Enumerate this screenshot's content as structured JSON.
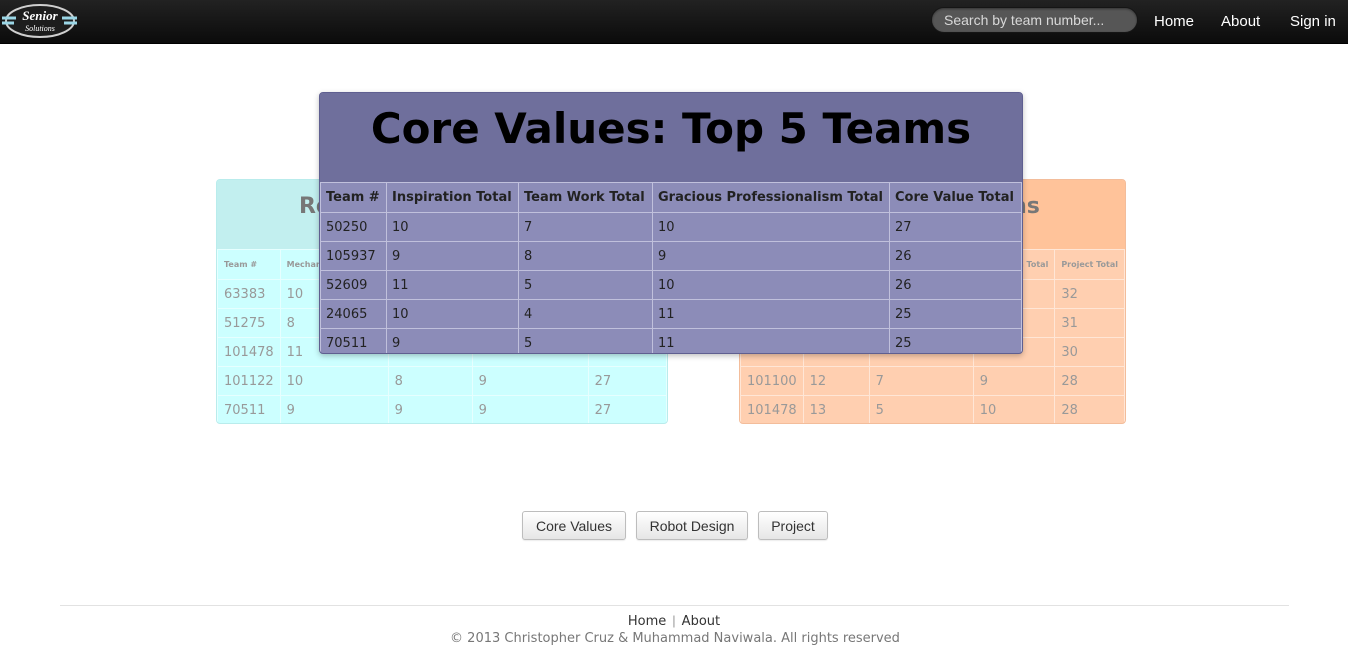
{
  "navbar": {
    "logo_text": "Senior Solutions",
    "search_placeholder": "Search by team number...",
    "links": [
      "Home",
      "About",
      "Sign in"
    ]
  },
  "robot_panel": {
    "title_visible": "Ro",
    "headers": [
      "Team #",
      "Mechanic"
    ],
    "rows": [
      [
        "63383",
        "10",
        "",
        "",
        ""
      ],
      [
        "51275",
        "8",
        "",
        "",
        ""
      ],
      [
        "101478",
        "11",
        "",
        "",
        ""
      ],
      [
        "101122",
        "10",
        "8",
        "9",
        "27"
      ],
      [
        "70511",
        "9",
        "9",
        "9",
        "27"
      ]
    ]
  },
  "project_panel": {
    "title_visible": "ns",
    "headers": [
      "",
      "",
      "",
      "ion Total",
      "Project Total"
    ],
    "rows": [
      [
        "",
        "",
        "",
        "",
        "32"
      ],
      [
        "",
        "",
        "",
        "",
        "31"
      ],
      [
        "",
        "",
        "",
        "",
        "30"
      ],
      [
        "101100",
        "12",
        "7",
        "9",
        "28"
      ],
      [
        "101478",
        "13",
        "5",
        "10",
        "28"
      ]
    ]
  },
  "core_values": {
    "title": "Core Values: Top 5 Teams",
    "headers": [
      "Team #",
      "Inspiration Total",
      "Team Work Total",
      "Gracious Professionalism Total",
      "Core Value Total"
    ],
    "rows": [
      [
        "50250",
        "10",
        "7",
        "10",
        "27"
      ],
      [
        "105937",
        "9",
        "8",
        "9",
        "26"
      ],
      [
        "52609",
        "11",
        "5",
        "10",
        "26"
      ],
      [
        "24065",
        "10",
        "4",
        "11",
        "25"
      ],
      [
        "70511",
        "9",
        "5",
        "11",
        "25"
      ]
    ]
  },
  "buttons": [
    "Core Values",
    "Robot Design",
    "Project"
  ],
  "footer": {
    "links": [
      "Home",
      "About"
    ],
    "separator": "|",
    "copyright": "© 2013 Christopher Cruz & Muhammad Naviwala. All rights reserved"
  },
  "colors": {
    "navbar": "#111111",
    "robot_panel": "#ccffff",
    "project_panel": "#ffcfb0",
    "overlay": "#8c8cb8",
    "overlay_header": "#6f6f9c"
  }
}
